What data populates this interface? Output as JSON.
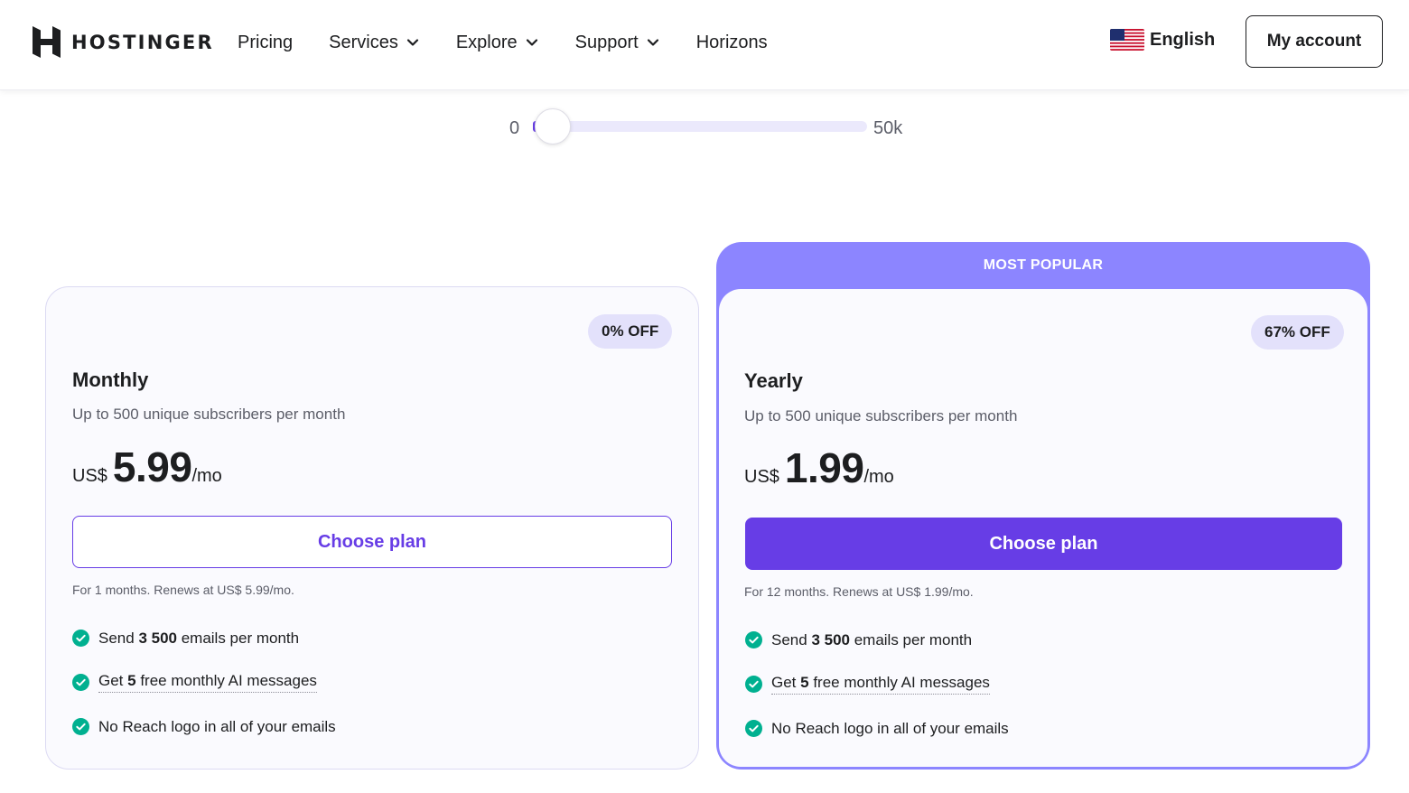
{
  "brand": {
    "name": "HOSTINGER"
  },
  "nav": {
    "items": [
      {
        "label": "Pricing",
        "dropdown": false
      },
      {
        "label": "Services",
        "dropdown": true
      },
      {
        "label": "Explore",
        "dropdown": true
      },
      {
        "label": "Support",
        "dropdown": true
      },
      {
        "label": "Horizons",
        "dropdown": false
      }
    ]
  },
  "header": {
    "language": "English",
    "account_label": "My account"
  },
  "slider": {
    "min_label": "0",
    "max_label": "50k",
    "value_fraction": 0.06
  },
  "plans": {
    "monthly": {
      "badge": "0% OFF",
      "name": "Monthly",
      "subtitle": "Up to 500 unique subscribers per month",
      "currency": "US$",
      "price": "5.99",
      "period": "/mo",
      "cta": "Choose plan",
      "renewal": "For 1 months. Renews at US$ 5.99/mo.",
      "features": [
        {
          "pre": "Send ",
          "bold": "3 500",
          "post": " emails per month"
        },
        {
          "pre": "Get ",
          "bold": "5",
          "post": " free monthly AI messages"
        },
        {
          "pre": "No Reach logo in all of your emails",
          "bold": "",
          "post": ""
        }
      ]
    },
    "yearly": {
      "ribbon": "MOST POPULAR",
      "badge": "67% OFF",
      "name": "Yearly",
      "subtitle": "Up to 500 unique subscribers per month",
      "currency": "US$",
      "price": "1.99",
      "period": "/mo",
      "cta": "Choose plan",
      "renewal": "For 12 months. Renews at US$ 1.99/mo.",
      "features": [
        {
          "pre": "Send ",
          "bold": "3 500",
          "post": " emails per month"
        },
        {
          "pre": "Get ",
          "bold": "5",
          "post": " free monthly AI messages"
        },
        {
          "pre": "No Reach logo in all of your emails",
          "bold": "",
          "post": ""
        }
      ]
    }
  },
  "colors": {
    "accent": "#673de6",
    "popular": "#8c85ff",
    "check": "#00b090",
    "badge_bg": "#e3e1fb"
  },
  "icons": {
    "chevron": "chevron-down-icon",
    "check": "check-circle-icon",
    "flag": "us-flag-icon",
    "logo": "hostinger-logo-icon"
  }
}
